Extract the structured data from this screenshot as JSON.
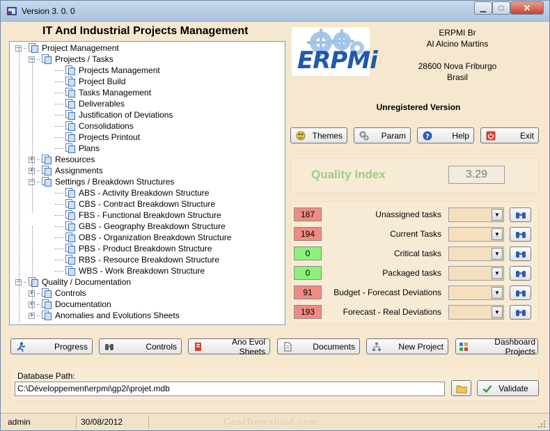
{
  "window": {
    "title": "Version 3. 0. 0",
    "minimize": "▁",
    "maximize": "□",
    "close": "✕"
  },
  "main_title": "IT And Industrial Projects Management",
  "tree": [
    {
      "label": "Project Management",
      "level": 0,
      "expander": "⊟"
    },
    {
      "label": "Projects / Tasks",
      "level": 1,
      "expander": "⊟"
    },
    {
      "label": "Projects Management",
      "level": 2,
      "expander": ""
    },
    {
      "label": "Project Build",
      "level": 2,
      "expander": ""
    },
    {
      "label": "Tasks Management",
      "level": 2,
      "expander": ""
    },
    {
      "label": "Deliverables",
      "level": 2,
      "expander": ""
    },
    {
      "label": "Justification of Deviations",
      "level": 2,
      "expander": ""
    },
    {
      "label": "Consolidations",
      "level": 2,
      "expander": ""
    },
    {
      "label": "Projects Printout",
      "level": 2,
      "expander": ""
    },
    {
      "label": "Plans",
      "level": 2,
      "expander": ""
    },
    {
      "label": "Resources",
      "level": 1,
      "expander": "⊞"
    },
    {
      "label": "Assignments",
      "level": 1,
      "expander": "⊞"
    },
    {
      "label": "Settings / Breakdown Structures",
      "level": 1,
      "expander": "⊟"
    },
    {
      "label": "ABS - Activity Breakdown Structure",
      "level": 2,
      "expander": ""
    },
    {
      "label": "CBS - Contract Breakdown Structure",
      "level": 2,
      "expander": ""
    },
    {
      "label": "FBS - Functional Breakdown Structure",
      "level": 2,
      "expander": ""
    },
    {
      "label": "GBS - Geography Breakdown Structure",
      "level": 2,
      "expander": ""
    },
    {
      "label": "OBS - Organization Breakdown Structure",
      "level": 2,
      "expander": ""
    },
    {
      "label": "PBS - Product Breakdown Structure",
      "level": 2,
      "expander": ""
    },
    {
      "label": "RBS - Resource Breakdown Structure",
      "level": 2,
      "expander": ""
    },
    {
      "label": "WBS - Work Breakdown Structure",
      "level": 2,
      "expander": ""
    },
    {
      "label": "Quality / Documentation",
      "level": 0,
      "expander": "⊟"
    },
    {
      "label": "Controls",
      "level": 1,
      "expander": "⊞"
    },
    {
      "label": "Documentation",
      "level": 1,
      "expander": "⊞"
    },
    {
      "label": "Anomalies and Evolutions Sheets",
      "level": 1,
      "expander": "⊞"
    }
  ],
  "logo": {
    "text": "ERPMi"
  },
  "company": {
    "name": "ERPMI Br",
    "person": "Al Alcino Martins",
    "city": "28600 Nova Friburgo",
    "country": "Brasil"
  },
  "license_status": "Unregistered Version",
  "top_buttons": {
    "themes": "Themes",
    "param": "Param",
    "help": "Help",
    "exit": "Exit"
  },
  "quality": {
    "label": "Quality Index",
    "value": "3.29"
  },
  "metrics": [
    {
      "value": "187",
      "label": "Unassigned tasks",
      "color": "#f08a84"
    },
    {
      "value": "194",
      "label": "Current Tasks",
      "color": "#f08a84"
    },
    {
      "value": "0",
      "label": "Critical tasks",
      "color": "#8cf27c"
    },
    {
      "value": "0",
      "label": "Packaged tasks",
      "color": "#8cf27c"
    },
    {
      "value": "91",
      "label": "Budget - Forecast Deviations",
      "color": "#f08a84"
    },
    {
      "value": "193",
      "label": "Forecast - Real Deviations",
      "color": "#f08a84"
    }
  ],
  "bottom_buttons": {
    "progress": "Progress",
    "controls": "Controls",
    "ano_evol": "Ano Evol Sheets",
    "documents": "Documents",
    "new_project": "New Project",
    "dashboard": "Dashboard Projects"
  },
  "database": {
    "label": "Database Path:",
    "path": "C:\\Développement\\erpmi\\gp2i\\projet.mdb",
    "validate": "Validate"
  },
  "status": {
    "user": "admin",
    "date": "30/08/2012"
  },
  "watermark": "GearDownload.com"
}
